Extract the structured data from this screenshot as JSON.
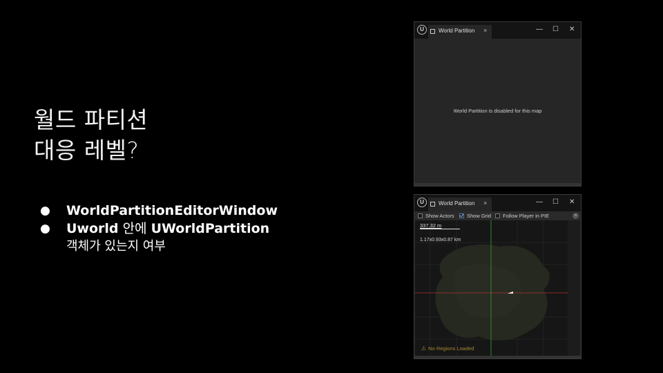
{
  "slide": {
    "title_line1": "월드 파티션",
    "title_line2": "대응 레벨?",
    "bullets": [
      {
        "bold": "WorldPartitionEditorWindow"
      },
      {
        "bold": "Uworld",
        "normal": " 안에 ",
        "bold2": "UWorldPartition",
        "continuation": "객체가 있는지 여부"
      }
    ],
    "bullet_glyph": "●"
  },
  "window_disabled": {
    "tab_label": "World Partition",
    "tab_close": "×",
    "minimize": "—",
    "maximize": "☐",
    "close": "✕",
    "logo": "U",
    "message": "World Partition is disabled for this map"
  },
  "window_enabled": {
    "tab_label": "World Partition",
    "tab_close": "×",
    "minimize": "—",
    "maximize": "☐",
    "close": "✕",
    "logo": "U",
    "toolbar": {
      "show_actors": "Show Actors",
      "show_actors_checked": false,
      "show_grid": "Show Grid",
      "show_grid_checked": true,
      "follow_player": "Follow Player in PIE",
      "follow_player_checked": false,
      "overflow": "»"
    },
    "scale_label": "337.32 m",
    "dimensions_label": "1.17x0.93x0.87 km",
    "status_warning": "No Regions Loaded",
    "warning_icon": "warning-icon"
  },
  "colors": {
    "background": "#000000",
    "window_bg": "#262626",
    "titlebar_bg": "#141414",
    "axis_green": "#3aa040",
    "axis_red": "#b03030",
    "warning": "#a88830"
  }
}
